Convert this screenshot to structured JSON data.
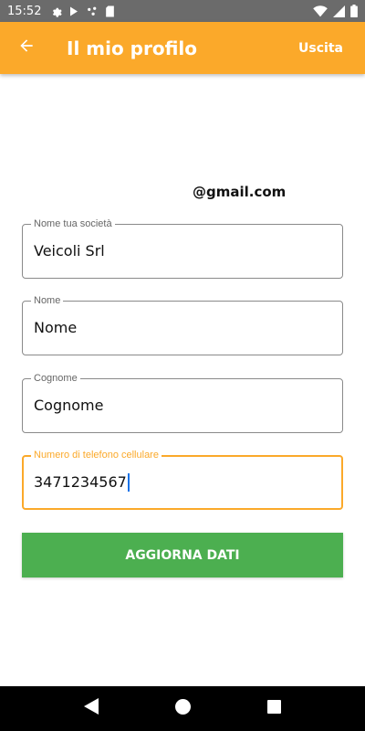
{
  "status_bar": {
    "time": "15:52",
    "left_icons": [
      "gear-icon",
      "play-store-icon",
      "dots-icon",
      "sd-card-icon"
    ],
    "right_icons": [
      "wifi-icon",
      "signal-icon",
      "battery-icon"
    ]
  },
  "app_bar": {
    "back_icon": "arrow-back-icon",
    "title": "Il mio profilo",
    "logout_label": "Uscita",
    "color": "#FBA92A"
  },
  "profile": {
    "email": "@gmail.com"
  },
  "form": {
    "company": {
      "label": "Nome tua società",
      "value": "Veicoli Srl"
    },
    "first_name": {
      "label": "Nome",
      "value": "Nome"
    },
    "last_name": {
      "label": "Cognome",
      "value": "Cognome"
    },
    "phone": {
      "label": "Numero di telefono cellulare",
      "value": "3471234567",
      "focused": true
    },
    "submit_label": "AGGIORNA DATI",
    "submit_color": "#4CAF50"
  },
  "nav_bar": {
    "buttons": [
      "back-triangle-icon",
      "home-circle-icon",
      "recents-square-icon"
    ]
  }
}
